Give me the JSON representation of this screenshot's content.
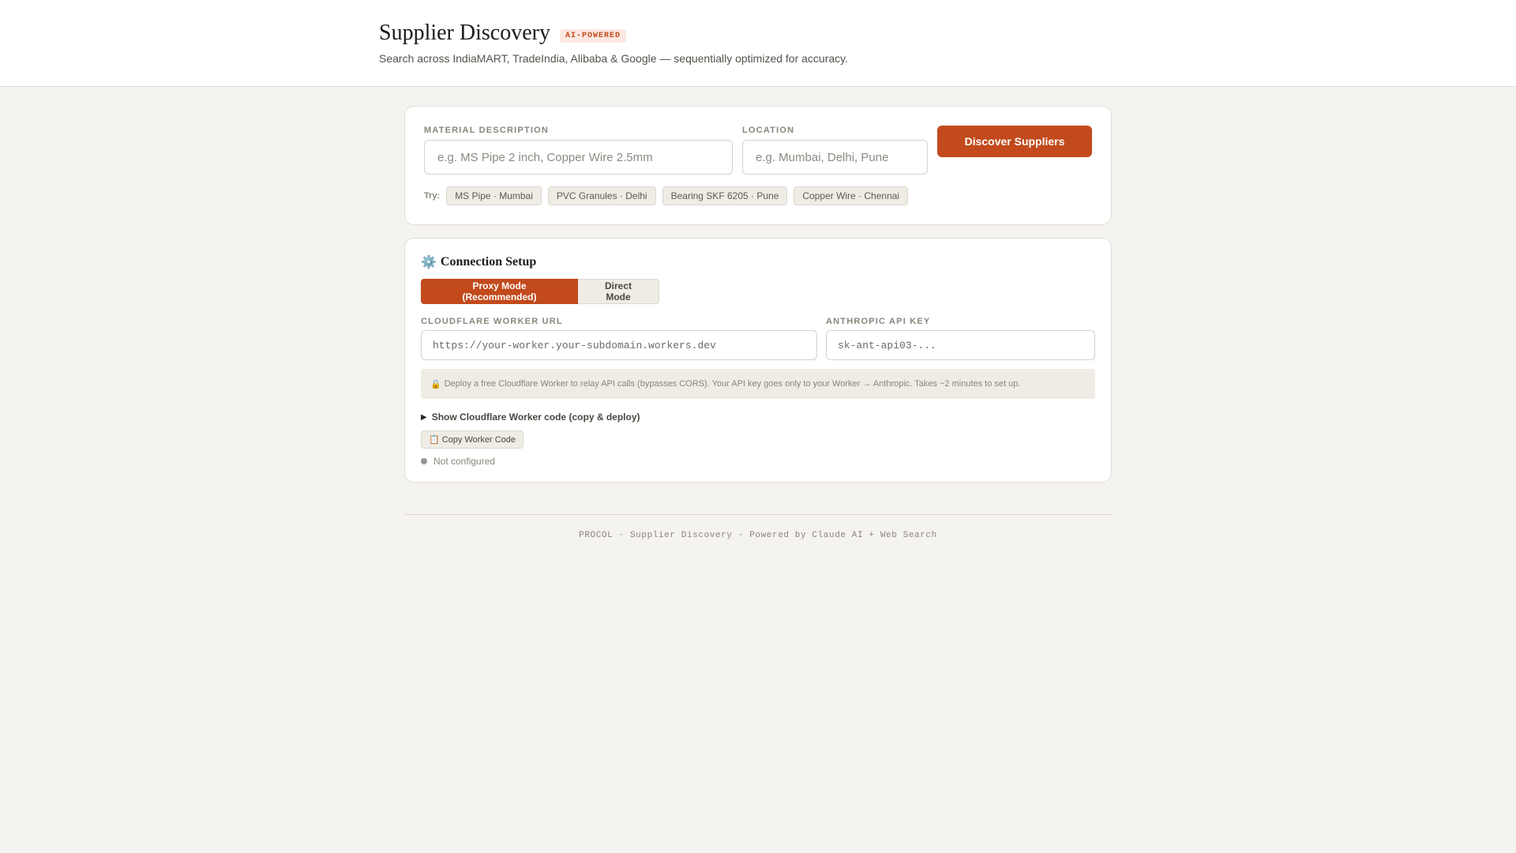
{
  "header": {
    "title": "Supplier Discovery",
    "badge": "AI-POWERED",
    "subtitle": "Search across IndiaMART, TradeIndia, Alibaba & Google — sequentially optimized for accuracy."
  },
  "search": {
    "material_label": "MATERIAL DESCRIPTION",
    "material_placeholder": "e.g. MS Pipe 2 inch, Copper Wire 2.5mm",
    "material_value": "",
    "location_label": "LOCATION",
    "location_placeholder": "e.g. Mumbai, Delhi, Pune",
    "location_value": "",
    "submit_label": "Discover Suppliers",
    "try_label": "Try:",
    "suggestions": [
      "MS Pipe · Mumbai",
      "PVC Granules · Delhi",
      "Bearing SKF 6205 · Pune",
      "Copper Wire · Chennai"
    ]
  },
  "connection": {
    "icon": "gear-icon",
    "title": "Connection Setup",
    "modes": [
      "Proxy Mode (Recommended)",
      "Direct Mode"
    ],
    "active_mode": "Proxy Mode (Recommended)",
    "worker_url_label": "CLOUDFLARE WORKER URL",
    "worker_url_placeholder": "https://your-worker.your-subdomain.workers.dev",
    "worker_url_value": "",
    "api_key_label": "ANTHROPIC API KEY",
    "api_key_placeholder": "sk-ant-api03-...",
    "api_key_value": "",
    "info_icon": "lock-icon",
    "info_text": "Deploy a free Cloudflare Worker to relay API calls (bypasses CORS). Your API key goes only to your Worker → Anthropic. Takes ~2 minutes to set up.",
    "show_code_label": "Show Cloudflare Worker code (copy & deploy)",
    "copy_button_icon": "clipboard-icon",
    "copy_button_label": "Copy Worker Code",
    "status_text": "Not configured"
  },
  "footer": {
    "text": "PROCOL · Supplier Discovery · Powered by Claude AI + Web Search"
  },
  "colors": {
    "accent": "#c24a1c",
    "background": "#f5f3ef",
    "card": "#ffffff",
    "status_dot": "#9a968f"
  }
}
